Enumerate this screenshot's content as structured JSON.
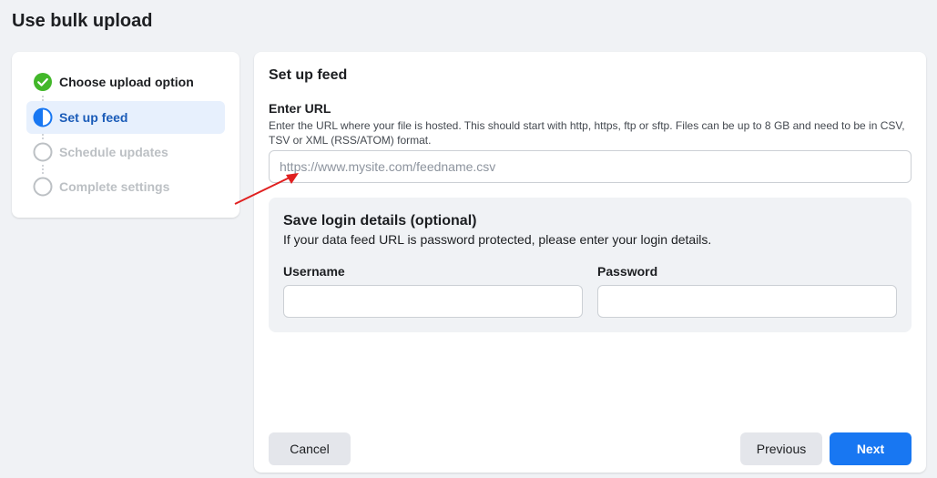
{
  "page": {
    "title": "Use bulk upload"
  },
  "steps": [
    {
      "label": "Choose upload option",
      "state": "done"
    },
    {
      "label": "Set up feed",
      "state": "active"
    },
    {
      "label": "Schedule updates",
      "state": "pending"
    },
    {
      "label": "Complete settings",
      "state": "pending"
    }
  ],
  "feed": {
    "title": "Set up feed",
    "url_label": "Enter URL",
    "url_help": "Enter the URL where your file is hosted. This should start with http, https, ftp or sftp. Files can be up to 8 GB and need to be in CSV, TSV or XML (RSS/ATOM) format.",
    "url_placeholder": "https://www.mysite.com/feedname.csv",
    "url_value": ""
  },
  "login": {
    "title": "Save login details (optional)",
    "description": "If your data feed URL is password protected, please enter your login details.",
    "username_label": "Username",
    "username_value": "",
    "password_label": "Password",
    "password_value": ""
  },
  "actions": {
    "cancel": "Cancel",
    "previous": "Previous",
    "next": "Next"
  },
  "colors": {
    "done": "#42b72a",
    "active": "#1877f2",
    "pending": "#bcc0c4",
    "annotation": "#e02020"
  }
}
